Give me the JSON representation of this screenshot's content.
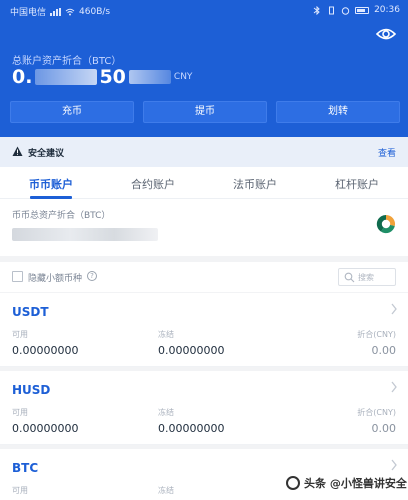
{
  "status_bar": {
    "carrier": "中国电信",
    "speed": "460B/s",
    "battery": "",
    "time": "20:36"
  },
  "header": {
    "asset_label": "总账户资产折合（BTC）",
    "asset_prefix": "0.",
    "asset_mid": "50",
    "asset_unit": "CNY",
    "buttons": {
      "deposit": "充币",
      "withdraw": "提币",
      "transfer": "划转"
    }
  },
  "advice": {
    "text": "安全建议",
    "link": "查看"
  },
  "tabs": [
    "币币账户",
    "合约账户",
    "法币账户",
    "杠杆账户"
  ],
  "summary": {
    "label": "币币总资产折合（BTC）"
  },
  "filter": {
    "label": "隐藏小额币种",
    "help": "?",
    "search_placeholder": "搜索"
  },
  "columns": {
    "available": "可用",
    "frozen": "冻结",
    "equivalent": "折合(CNY)"
  },
  "coins": [
    {
      "name": "USDT",
      "available": "0.00000000",
      "frozen": "0.00000000",
      "cny": "0.00"
    },
    {
      "name": "HUSD",
      "available": "0.00000000",
      "frozen": "0.00000000",
      "cny": "0.00"
    },
    {
      "name": "BTC",
      "available": "",
      "frozen": "",
      "cny": ""
    }
  ],
  "watermark": {
    "text": "头条 @小怪兽讲安全"
  },
  "colors": {
    "brand_blue": "#1d5fd6",
    "background": "#f2f3f5",
    "warning_advice_bg": "#e9eff9"
  }
}
